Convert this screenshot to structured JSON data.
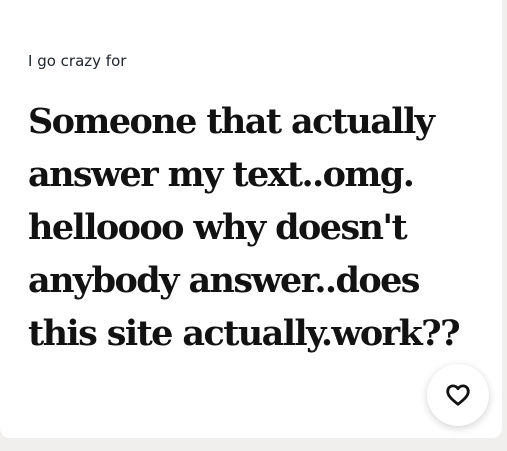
{
  "card": {
    "prompt": "I go crazy for",
    "answer": "Someone that actually\nanswer my text..omg.\nhelloooo why doesn't\nanybody answer..does\nthis site actually.work??"
  },
  "like_button": {
    "icon": "heart-icon"
  },
  "colors": {
    "page_background": "#f0efed",
    "card_background": "#ffffff",
    "text": "#121212"
  }
}
